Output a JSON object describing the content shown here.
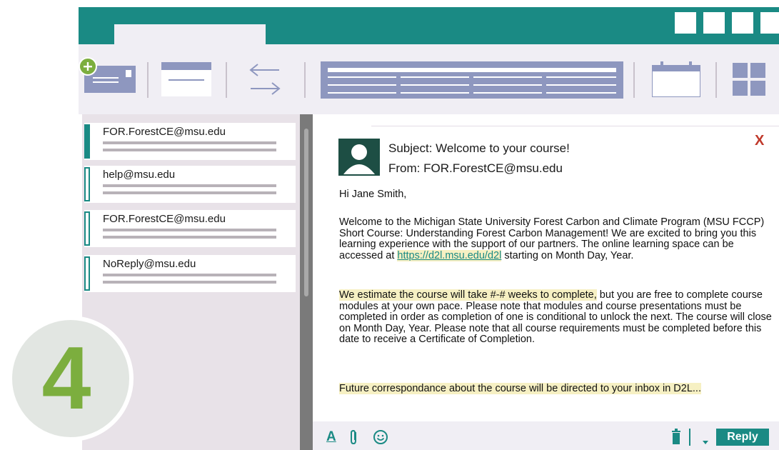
{
  "window": {
    "accent_color": "#1a8a84",
    "toolbar_icons": [
      "new-mail-icon",
      "mail-window-icon",
      "transfer-icon",
      "grid-table-icon",
      "calendar-icon",
      "apps-grid-icon"
    ],
    "new_mail_badge_color": "#7cae3e"
  },
  "mail_list": {
    "items": [
      {
        "address": "FOR.ForestCE@msu.edu",
        "selected": true
      },
      {
        "address": "help@msu.edu",
        "selected": false
      },
      {
        "address": "FOR.ForestCE@msu.edu",
        "selected": false
      },
      {
        "address": "NoReply@msu.edu",
        "selected": false
      }
    ]
  },
  "message": {
    "subject": "Subject: Welcome to your course!",
    "from": "From: FOR.ForestCE@msu.edu",
    "close_label": "X",
    "greeting": "Hi Jane Smith,",
    "p1_before_link": "Welcome to the Michigan State University Forest Carbon and Climate Program (MSU FCCP) Short Course: Understanding Forest Carbon Management! We are excited to bring you this learning experience with the support of our partners. The online learning space can be accessed at ",
    "link": "https://d2l.msu.edu/d2l",
    "p1_after_link": " starting on Month Day, Year.",
    "p2_highlight": "We estimate the course will take #-# weeks to complete,",
    "p2_rest": " but you are free to complete course modules at your own pace. Please note that modules and course presentations must be completed in order as completion of one is conditional to unlock the next. The course will close on Month Day, Year. Please note that all course requirements must be completed before this date to receive a Certificate of Completion.",
    "p3_highlight": "Future correspondance about the course will be directed to your inbox in D2L..."
  },
  "footer": {
    "format_label": "A",
    "reply_label": "Reply"
  },
  "step": {
    "number": "4",
    "color": "#7cae3e"
  }
}
